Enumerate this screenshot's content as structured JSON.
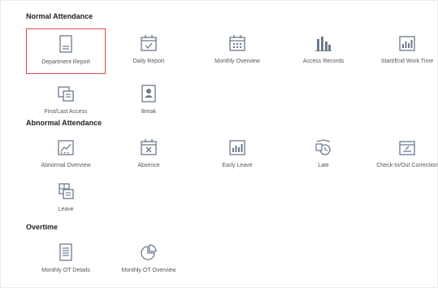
{
  "sections": [
    {
      "title": "Normal Attendance",
      "items": [
        {
          "label": "Department Report",
          "icon": "document-icon",
          "selected": true
        },
        {
          "label": "Daily Report",
          "icon": "calendar-check-icon"
        },
        {
          "label": "Monthly Overview",
          "icon": "calendar-grid-icon"
        },
        {
          "label": "Access Records",
          "icon": "building-chart-icon"
        },
        {
          "label": "Start/End Work Time",
          "icon": "bar-chart-icon"
        },
        {
          "label": "First/Last Access",
          "icon": "stacked-docs-icon"
        },
        {
          "label": "Break",
          "icon": "person-badge-icon"
        }
      ]
    },
    {
      "title": "Abnormal Attendance",
      "items": [
        {
          "label": "Abnormal Overview",
          "icon": "trend-chart-icon"
        },
        {
          "label": "Absence",
          "icon": "calendar-x-icon"
        },
        {
          "label": "Early Leave",
          "icon": "bar-chart-icon"
        },
        {
          "label": "Late",
          "icon": "clock-alarm-icon"
        },
        {
          "label": "Check-In/Out Correction",
          "icon": "window-pen-icon"
        },
        {
          "label": "Leave",
          "icon": "leave-form-icon"
        }
      ]
    },
    {
      "title": "Overtime",
      "items": [
        {
          "label": "Monthly OT Details",
          "icon": "document-list-icon"
        },
        {
          "label": "Monthly OT Overview",
          "icon": "pie-chart-icon"
        }
      ]
    }
  ],
  "colors": {
    "icon": "#6b7a8c",
    "selected_border": "#e0484f"
  }
}
